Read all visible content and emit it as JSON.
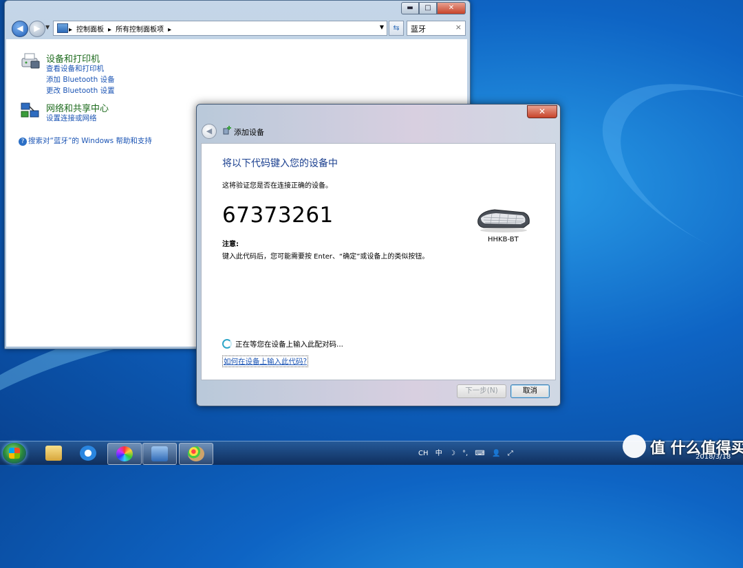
{
  "control_panel": {
    "breadcrumb": [
      "控制面板",
      "所有控制面板项"
    ],
    "search_value": "蓝牙",
    "devices_section": {
      "title": "设备和打印机",
      "links": [
        "查看设备和打印机",
        "添加 Bluetooth 设备",
        "更改 Bluetooth 设置"
      ]
    },
    "network_section": {
      "title": "网络和共享中心",
      "links": [
        "设置连接或网络"
      ]
    },
    "help_link": "搜索对“蓝牙”的 Windows 帮助和支持"
  },
  "dialog": {
    "title": "添加设备",
    "instruction": "将以下代码键入您的设备中",
    "verify_text": "这将验证您是否在连接正确的设备。",
    "pairing_code": "67373261",
    "note_heading": "注意:",
    "note_text": "键入此代码后，您可能需要按 Enter、“确定”或设备上的类似按钮。",
    "device_name": "HHKB-BT",
    "waiting_text": "正在等您在设备上输入此配对码...",
    "help_link": "如何在设备上输入此代码?",
    "next_button": "下一步(N)",
    "cancel_button": "取消"
  },
  "taskbar": {
    "tray_items": [
      "CH",
      "中",
      "☽",
      "°,",
      "⌨",
      "👤",
      "⤢"
    ],
    "date": "2018/3/18"
  },
  "watermark": "值 什么值得买"
}
